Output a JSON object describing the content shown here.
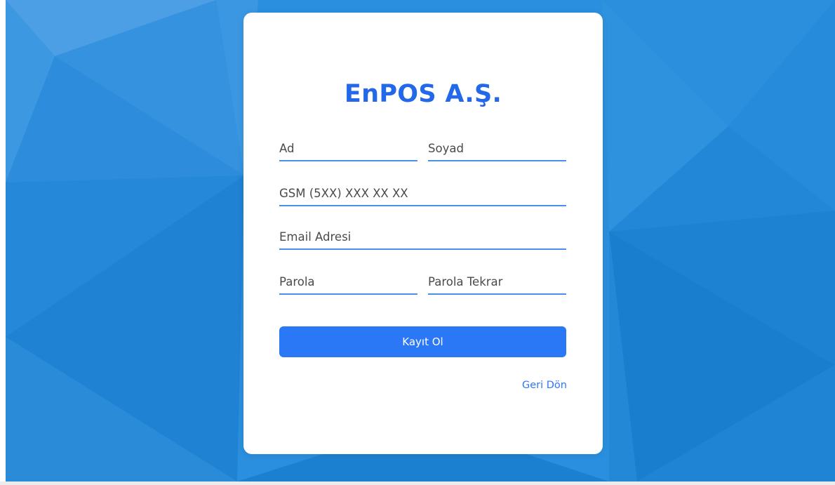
{
  "brand": {
    "title": "EnPOS A.Ş.",
    "color": "#2468ea"
  },
  "background": {
    "base_color": "#2a8fde",
    "style": "low-poly blue"
  },
  "form": {
    "first_name": {
      "placeholder": "Ad",
      "value": ""
    },
    "last_name": {
      "placeholder": "Soyad",
      "value": ""
    },
    "phone": {
      "placeholder": "GSM (5XX) XXX XX XX",
      "value": ""
    },
    "email": {
      "placeholder": "Email Adresi",
      "value": ""
    },
    "password": {
      "placeholder": "Parola",
      "value": ""
    },
    "password_repeat": {
      "placeholder": "Parola Tekrar",
      "value": ""
    },
    "submit_label": "Kayıt Ol",
    "back_label": "Geri Dön",
    "accent_color": "#2a78f5"
  }
}
